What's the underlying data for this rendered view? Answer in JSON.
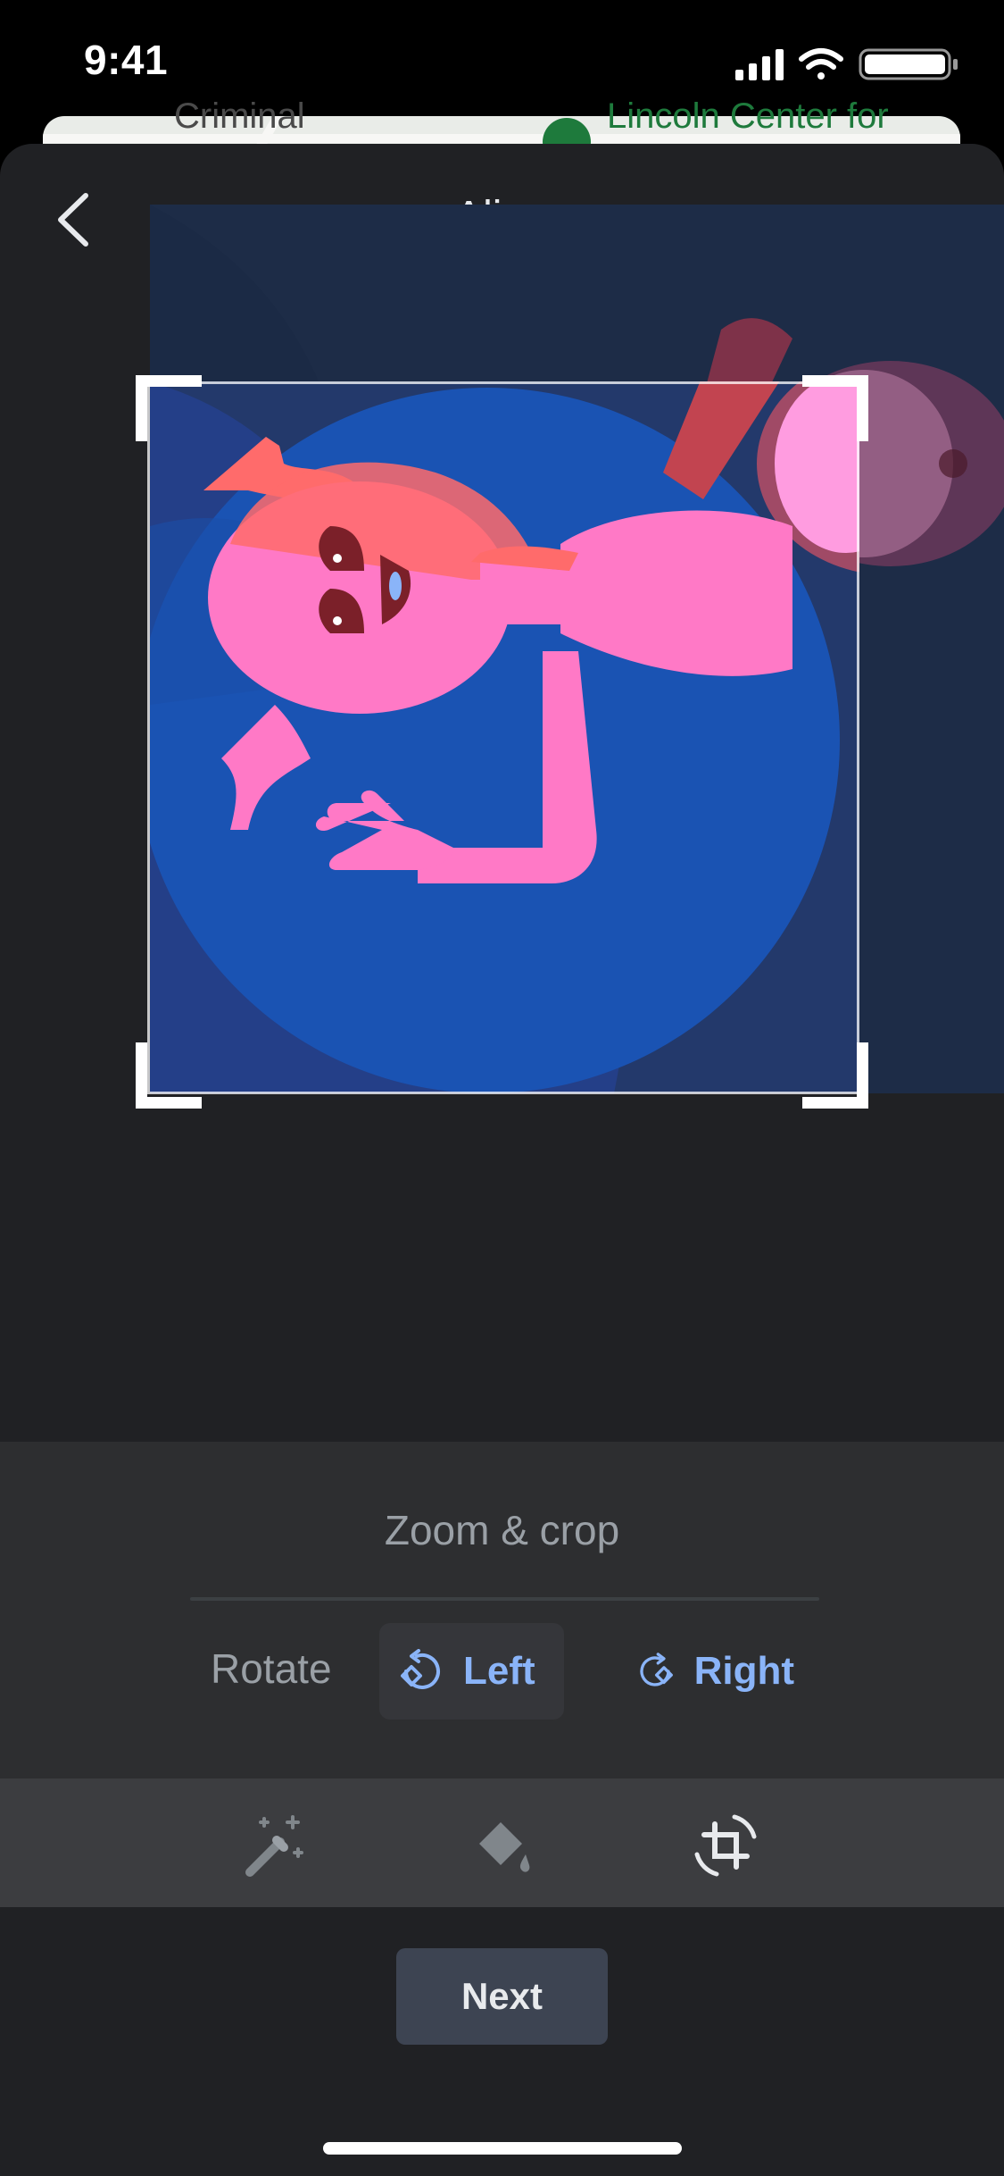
{
  "status_bar": {
    "time": "9:41"
  },
  "map": {
    "label_left": "Criminal",
    "label_right": "Lincoln Center for"
  },
  "header": {
    "title": "Alien",
    "back_icon": "chevron-left-icon",
    "more_icon": "more-horizontal-icon"
  },
  "edit_panel": {
    "title": "Zoom & crop",
    "rotate_label": "Rotate",
    "rotate_left": "Left",
    "rotate_right": "Right"
  },
  "tools": [
    {
      "icon": "magic-wand-icon"
    },
    {
      "icon": "paint-bucket-icon"
    },
    {
      "icon": "crop-rotate-icon"
    }
  ],
  "next_button": "Next",
  "colors": {
    "accent": "#8ab4f8",
    "sheet_bg": "#202124",
    "panel_bg": "#2d2e30",
    "tool_bar_bg": "#3c3d40",
    "next_bg": "#3d4452",
    "alien_pink": "#ff79c6",
    "alien_red": "#ff6b6b",
    "planet_blue": "#1a53b3"
  }
}
